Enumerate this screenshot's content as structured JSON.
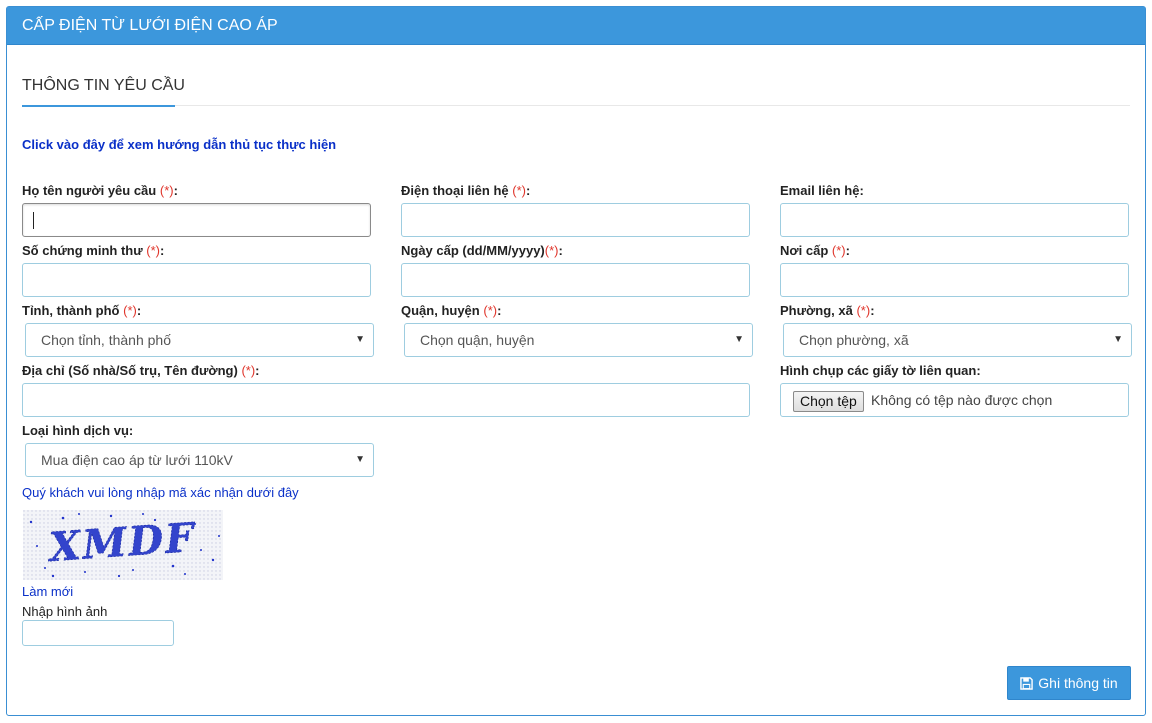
{
  "header": {
    "title": "CẤP ĐIỆN TỪ LƯỚI ĐIỆN CAO ÁP"
  },
  "section": {
    "title": "THÔNG TIN YÊU CẦU"
  },
  "guide_link": "Click vào đây để xem hướng dẫn thủ tục thực hiện",
  "required_mark": "(*)",
  "fields": {
    "full_name": {
      "label": "Họ tên người yêu cầu",
      "value": ""
    },
    "phone": {
      "label": "Điện thoại liên hệ",
      "value": ""
    },
    "email": {
      "label": "Email liên hệ:",
      "value": ""
    },
    "id_number": {
      "label": "Số chứng minh thư",
      "value": ""
    },
    "issue_date": {
      "label": "Ngày cấp (dd/MM/yyyy)",
      "value": ""
    },
    "issue_place": {
      "label": "Nơi cấp",
      "value": ""
    },
    "province": {
      "label": "Tỉnh, thành phố",
      "selected": "Chọn tỉnh, thành phố"
    },
    "district": {
      "label": "Quận, huyện",
      "selected": "Chọn quận, huyện"
    },
    "ward": {
      "label": "Phường, xã",
      "selected": "Chọn phường, xã"
    },
    "address": {
      "label": "Địa chỉ (Số nhà/Số trụ, Tên đường)",
      "value": ""
    },
    "attachments": {
      "label": "Hình chụp các giấy tờ liên quan:",
      "button": "Chọn tệp",
      "status": "Không có tệp nào được chọn"
    },
    "service_type": {
      "label": "Loại hình dịch vụ:",
      "selected": "Mua điện cao áp từ lưới 110kV"
    }
  },
  "captcha": {
    "note": "Quý khách vui lòng nhập mã xác nhận dưới đây",
    "text": "XMDF",
    "refresh": "Làm mới",
    "input_label": "Nhập hình ảnh",
    "value": ""
  },
  "save_button": {
    "label": "Ghi thông tin",
    "icon": "floppy-disk-icon"
  },
  "colors": {
    "primary": "#3c97dc",
    "link": "#0a30c8",
    "required": "#e0352b",
    "input_border": "#9ecde0"
  }
}
